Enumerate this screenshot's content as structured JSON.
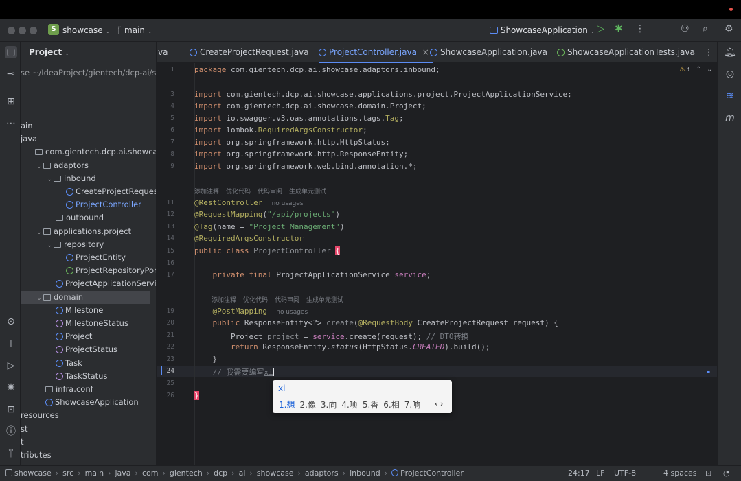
{
  "titlebar": {
    "project_badge": "S",
    "project_name": "showcase",
    "branch": "main",
    "run_config": "ShowcaseApplication"
  },
  "project_panel": {
    "title": "Project",
    "path_row": "se ~/IdeaProject/gientech/dcp-ai/sho",
    "tree": [
      {
        "label": "ain",
        "indent": 0,
        "icon": "none",
        "arrow": ""
      },
      {
        "label": "java",
        "indent": 0,
        "icon": "none",
        "arrow": ""
      },
      {
        "label": "com.gientech.dcp.ai.showcase",
        "indent": 1,
        "icon": "folder",
        "arrow": ""
      },
      {
        "label": "adaptors",
        "indent": 1,
        "icon": "folder",
        "arrow": "v"
      },
      {
        "label": "inbound",
        "indent": 2,
        "icon": "folder",
        "arrow": "v"
      },
      {
        "label": "CreateProjectRequest",
        "indent": 4,
        "icon": "class",
        "arrow": ""
      },
      {
        "label": "ProjectController",
        "indent": 4,
        "icon": "class",
        "arrow": "",
        "blue": true
      },
      {
        "label": "outbound",
        "indent": 3,
        "icon": "folder",
        "arrow": ""
      },
      {
        "label": "applications.project",
        "indent": 1,
        "icon": "folder",
        "arrow": "v"
      },
      {
        "label": "repository",
        "indent": 2,
        "icon": "folder",
        "arrow": "v"
      },
      {
        "label": "ProjectEntity",
        "indent": 4,
        "icon": "class",
        "arrow": ""
      },
      {
        "label": "ProjectRepositoryPort",
        "indent": 4,
        "icon": "iface",
        "arrow": ""
      },
      {
        "label": "ProjectApplicationService",
        "indent": 3,
        "icon": "class",
        "arrow": ""
      },
      {
        "label": "domain",
        "indent": 1,
        "icon": "folder",
        "arrow": "v",
        "selected": true
      },
      {
        "label": "Milestone",
        "indent": 3,
        "icon": "class",
        "arrow": ""
      },
      {
        "label": "MilestoneStatus",
        "indent": 3,
        "icon": "enum",
        "arrow": ""
      },
      {
        "label": "Project",
        "indent": 3,
        "icon": "class",
        "arrow": ""
      },
      {
        "label": "ProjectStatus",
        "indent": 3,
        "icon": "enum",
        "arrow": ""
      },
      {
        "label": "Task",
        "indent": 3,
        "icon": "class",
        "arrow": ""
      },
      {
        "label": "TaskStatus",
        "indent": 3,
        "icon": "enum",
        "arrow": ""
      },
      {
        "label": "infra.conf",
        "indent": 2,
        "icon": "folder",
        "arrow": ""
      },
      {
        "label": "ShowcaseApplication",
        "indent": 2,
        "icon": "class",
        "arrow": ""
      },
      {
        "label": "resources",
        "indent": 0,
        "icon": "none",
        "arrow": ""
      },
      {
        "label": "st",
        "indent": 0,
        "icon": "none",
        "arrow": ""
      },
      {
        "label": "t",
        "indent": 0,
        "icon": "none",
        "arrow": ""
      },
      {
        "label": "tributes",
        "indent": 0,
        "icon": "none",
        "arrow": ""
      }
    ]
  },
  "tabs": [
    {
      "label": "va",
      "icon": "none",
      "active": false
    },
    {
      "label": "CreateProjectRequest.java",
      "icon": "class",
      "active": false
    },
    {
      "label": "ProjectController.java",
      "icon": "class",
      "active": true,
      "close": "×"
    },
    {
      "label": "ShowcaseApplication.java",
      "icon": "class",
      "active": false
    },
    {
      "label": "ShowcaseApplicationTests.java",
      "icon": "test",
      "active": false
    }
  ],
  "editor": {
    "warning_count": "3",
    "hint_labels": [
      "添加注释",
      "优化代码",
      "代码审阅",
      "生成单元测试"
    ],
    "no_usages": "no usages",
    "line_numbers": [
      "1",
      "3",
      "4",
      "5",
      "6",
      "7",
      "8",
      "9",
      "11",
      "12",
      "13",
      "14",
      "15",
      "16",
      "17",
      "19",
      "20",
      "21",
      "22",
      "23",
      "24",
      "25",
      "26"
    ],
    "current_line": "24"
  },
  "ime": {
    "pinyin": "xi",
    "candidates": [
      "1.想",
      "2.像",
      "3.向",
      "4.项",
      "5.香",
      "6.相",
      "7.响"
    ],
    "nav": "‹ ›"
  },
  "statusbar": {
    "crumbs": [
      "showcase",
      "src",
      "main",
      "java",
      "com",
      "gientech",
      "dcp",
      "ai",
      "showcase",
      "adaptors",
      "inbound",
      "ProjectController"
    ],
    "position": "24:17",
    "line_sep": "LF",
    "encoding": "UTF-8",
    "indent": "4 spaces"
  }
}
